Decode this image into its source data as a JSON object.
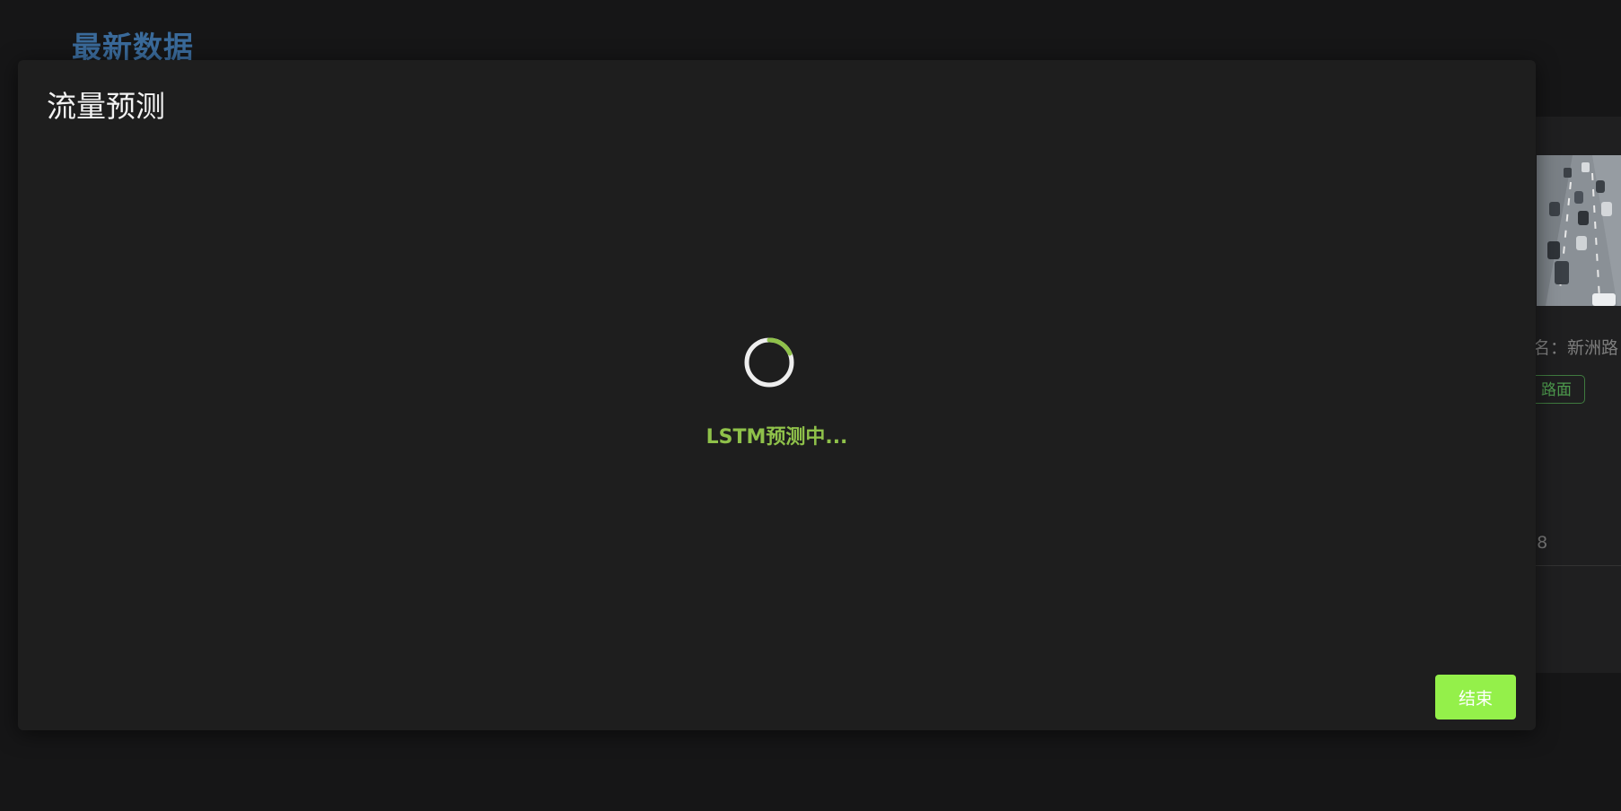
{
  "page": {
    "title": "最新数据"
  },
  "background_card": {
    "meta_label": "名：新洲路",
    "tag": "路面",
    "num_1": "8",
    "num_2": "78"
  },
  "modal": {
    "title": "流量预测",
    "loading_text": "LSTM预测中...",
    "end_button_label": "结束"
  },
  "colors": {
    "accent_green": "#94f04a",
    "loading_text": "#8fc14a",
    "page_title": "#3a6a9a",
    "modal_bg": "#1e1e1e",
    "page_bg": "#161617"
  }
}
